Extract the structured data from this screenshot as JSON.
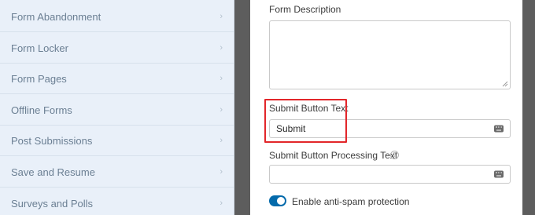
{
  "sidebar": {
    "items": [
      {
        "label": "Form Abandonment"
      },
      {
        "label": "Form Locker"
      },
      {
        "label": "Form Pages"
      },
      {
        "label": "Offline Forms"
      },
      {
        "label": "Post Submissions"
      },
      {
        "label": "Save and Resume"
      },
      {
        "label": "Surveys and Polls"
      }
    ],
    "chevron": "›"
  },
  "form": {
    "description_label": "Form Description",
    "description_value": "",
    "submit_text_label": "Submit Button Text",
    "submit_text_value": "Submit",
    "processing_text_label": "Submit Button Processing Text",
    "processing_text_value": "",
    "help_icon": "?",
    "antispam_label": "Enable anti-spam protection",
    "antispam_enabled": true
  },
  "colors": {
    "sidebar_bg": "#e9f0f9",
    "highlight": "#e2262a",
    "toggle_on": "#036aab"
  }
}
